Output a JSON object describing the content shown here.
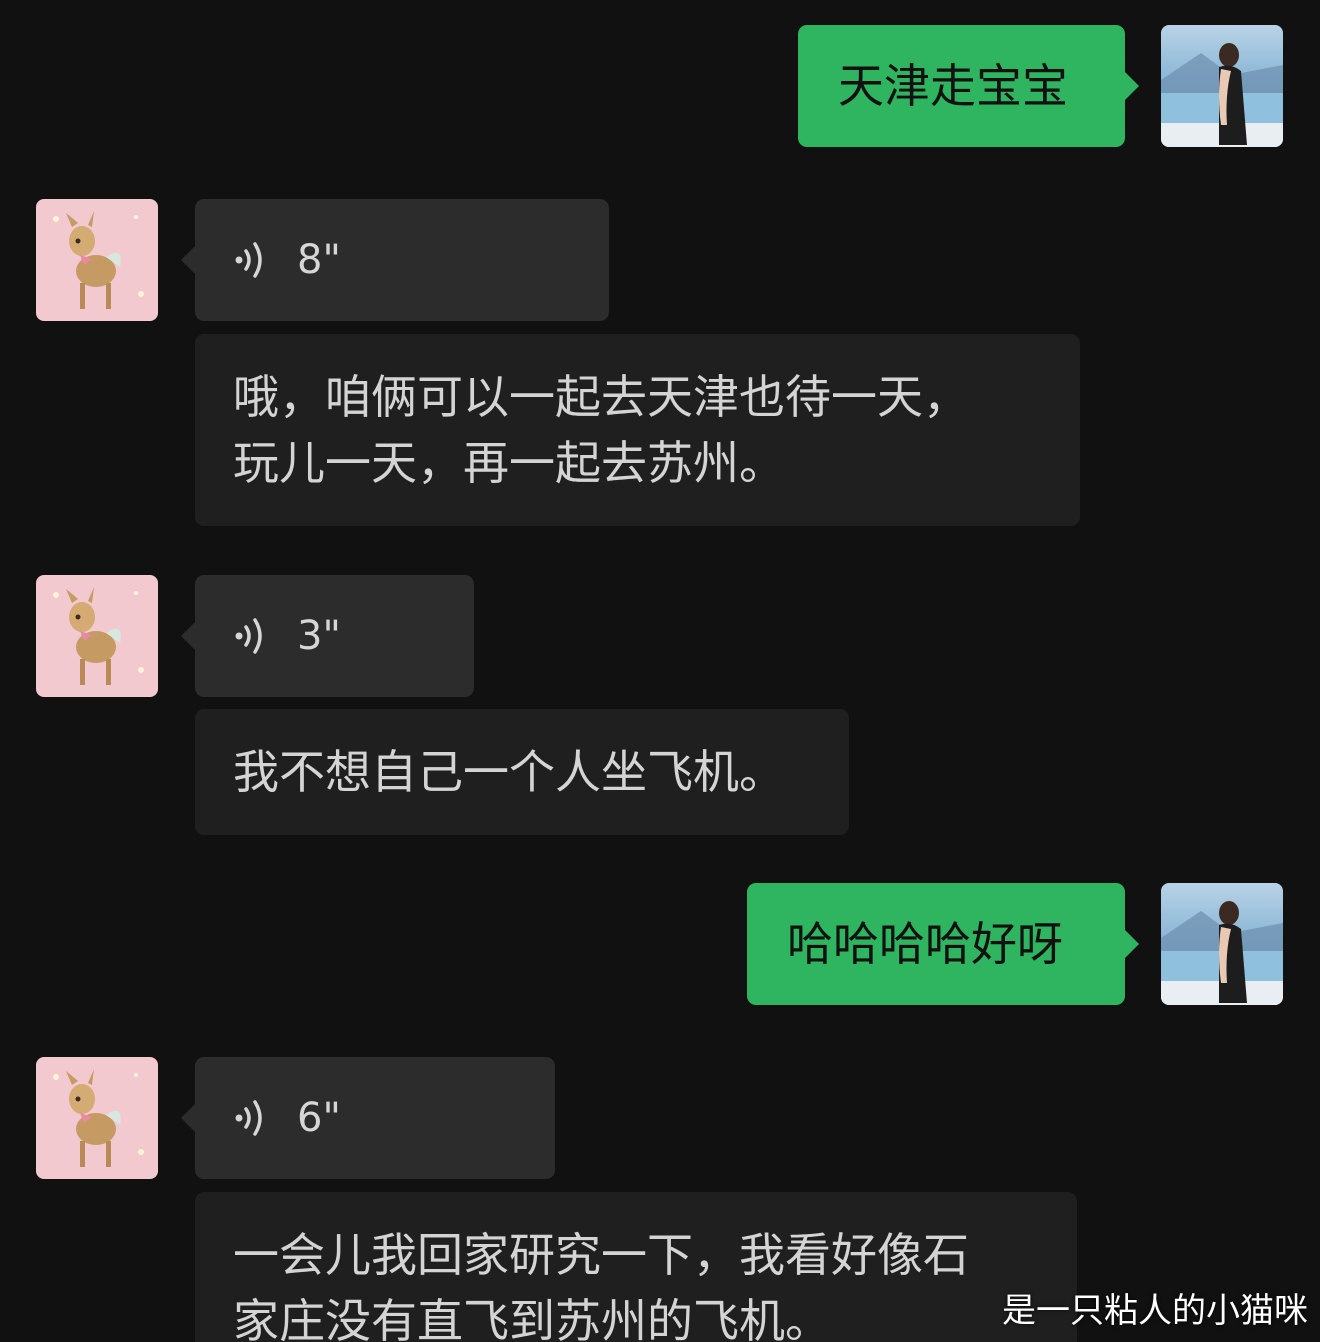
{
  "colors": {
    "background": "#111111",
    "sent_bubble": "#2fb45f",
    "received_voice_bubble": "#2c2c2c",
    "received_text_bubble": "#1f1f1f"
  },
  "messages": [
    {
      "sender": "me",
      "type": "text",
      "text": "天津走宝宝"
    },
    {
      "sender": "other",
      "type": "voice",
      "duration": "8\"",
      "icon": "voice-wave-icon"
    },
    {
      "sender": "other",
      "type": "text",
      "lines": [
        "哦，咱俩可以一起去天津也待一天，",
        "玩儿一天，再一起去苏州。"
      ]
    },
    {
      "sender": "other",
      "type": "voice",
      "duration": "3\"",
      "icon": "voice-wave-icon"
    },
    {
      "sender": "other",
      "type": "text",
      "lines": [
        "我不想自己一个人坐飞机。"
      ]
    },
    {
      "sender": "me",
      "type": "text",
      "text": "哈哈哈哈好呀"
    },
    {
      "sender": "other",
      "type": "voice",
      "duration": "6\"",
      "icon": "voice-wave-icon"
    },
    {
      "sender": "other",
      "type": "text",
      "lines": [
        "一会儿我回家研究一下，我看好像石",
        "家庄没有直飞到苏州的飞机。"
      ]
    }
  ],
  "avatars": {
    "me": "woman-lake-photo",
    "other": "fawn-illustration"
  },
  "watermark": "是一只粘人的小猫咪"
}
